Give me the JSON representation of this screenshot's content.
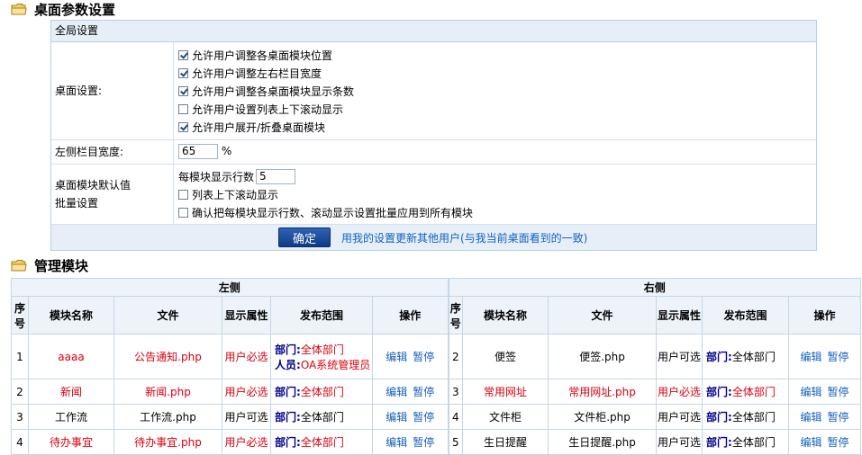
{
  "desktop_section": {
    "title": "桌面参数设置"
  },
  "global": {
    "header": "全局设置",
    "desktop_label": "桌面设置:",
    "options": [
      {
        "label": "允许用户调整各桌面模块位置",
        "checked": true
      },
      {
        "label": "允许用户调整左右栏目宽度",
        "checked": true
      },
      {
        "label": "允许用户调整各桌面模块显示条数",
        "checked": true
      },
      {
        "label": "允许用户设置列表上下滚动显示",
        "checked": false
      },
      {
        "label": "允许用户展开/折叠桌面模块",
        "checked": true
      }
    ],
    "left_width_label": "左侧栏目宽度:",
    "left_width_value": "65",
    "left_width_unit": "%",
    "batch_label_1": "桌面模块默认值",
    "batch_label_2": "批量设置",
    "rows_per_module_label": "每模块显示行数",
    "rows_per_module_value": "5",
    "scroll_label": "列表上下滚动显示",
    "apply_all_label": "确认把每模块显示行数、滚动显示设置批量应用到所有模块",
    "ok_button": "确定",
    "update_others_link": "用我的设置更新其他用户(与我当前桌面看到的一致)"
  },
  "manage_section": {
    "title": "管理模块"
  },
  "modules": {
    "left_title": "左侧",
    "right_title": "右侧",
    "headers": [
      "序号",
      "模块名称",
      "文件",
      "显示属性",
      "发布范围",
      "操作"
    ],
    "dept_label": "部门:",
    "person_label": "人员:",
    "edit_label": "编辑",
    "pause_label": "暂停",
    "left_rows": [
      {
        "no": "1",
        "name": "aaaa",
        "file": "公告通知.php",
        "attr": "用户必选",
        "dept": "全体部门",
        "person": "OA系统管理员",
        "red": true
      },
      {
        "no": "2",
        "name": "新闻",
        "file": "新闻.php",
        "attr": "用户必选",
        "dept": "全体部门",
        "red": true
      },
      {
        "no": "3",
        "name": "工作流",
        "file": "工作流.php",
        "attr": "用户可选",
        "dept": "全体部门",
        "red": false
      },
      {
        "no": "4",
        "name": "待办事宜",
        "file": "待办事宜.php",
        "attr": "用户必选",
        "dept": "全体部门",
        "red": true
      }
    ],
    "right_rows": [
      {
        "no": "2",
        "name": "便签",
        "file": "便签.php",
        "attr": "用户可选",
        "dept": "全体部门",
        "red": false
      },
      {
        "no": "3",
        "name": "常用网址",
        "file": "常用网址.php",
        "attr": "用户必选",
        "dept": "全体部门",
        "red": true
      },
      {
        "no": "4",
        "name": "文件柜",
        "file": "文件柜.php",
        "attr": "用户可选",
        "dept": "全体部门",
        "red": false
      },
      {
        "no": "5",
        "name": "生日提醒",
        "file": "生日提醒.php",
        "attr": "用户可选",
        "dept": "全体部门",
        "red": false
      }
    ]
  },
  "colors": {
    "accent": "#1560bd",
    "required_red": "#d9000f",
    "border": "#c4d6e8",
    "header_bg": "#e6eff8"
  }
}
